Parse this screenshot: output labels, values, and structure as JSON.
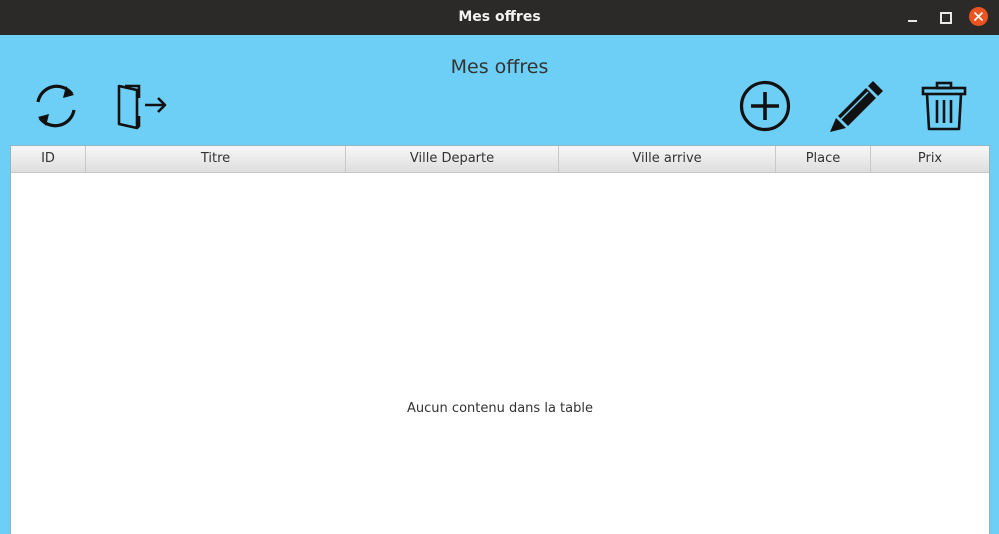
{
  "window": {
    "title": "Mes offres"
  },
  "header": {
    "title": "Mes offres"
  },
  "toolbar": {
    "left_icons": [
      "refresh-icon",
      "logout-icon"
    ],
    "right_icons": [
      "add-circle-icon",
      "edit-pencil-icon",
      "trash-icon"
    ]
  },
  "table": {
    "columns": [
      "ID",
      "Titre",
      "Ville Departe",
      "Ville arrive",
      "Place",
      "Prix"
    ],
    "rows": [],
    "empty_message": "Aucun contenu dans la table"
  },
  "colors": {
    "background": "#6ecff6",
    "titlebar": "#2c2a28",
    "close_button": "#e95420"
  }
}
